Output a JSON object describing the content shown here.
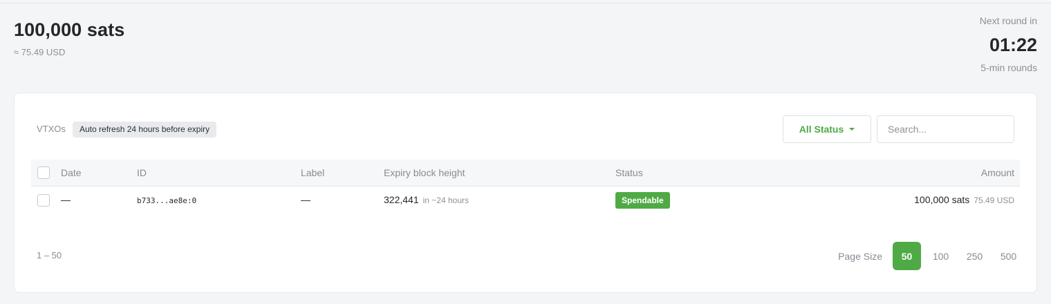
{
  "balance": {
    "amount": "100,000 sats",
    "fiat": "≈ 75.49 USD"
  },
  "round": {
    "label": "Next round in",
    "countdown": "01:22",
    "subtitle": "5-min rounds"
  },
  "vtxos": {
    "title": "VTXOs",
    "badge": "Auto refresh 24 hours before expiry",
    "status_filter": "All Status",
    "search_placeholder": "Search...",
    "columns": {
      "date": "Date",
      "id": "ID",
      "label": "Label",
      "expiry": "Expiry block height",
      "status": "Status",
      "amount": "Amount"
    },
    "rows": [
      {
        "date": "—",
        "id": "b733...ae8e:0",
        "label": "—",
        "expiry_height": "322,441",
        "expiry_eta": "in ~24 hours",
        "status": "Spendable",
        "amount": "100,000 sats",
        "amount_fiat": "75.49 USD"
      }
    ],
    "range": "1 – 50",
    "pagination": {
      "label": "Page Size",
      "options": [
        "50",
        "100",
        "250",
        "500"
      ],
      "selected": "50"
    }
  },
  "colors": {
    "accent": "#4faa45",
    "background": "#f4f5f6",
    "card": "#ffffff"
  }
}
